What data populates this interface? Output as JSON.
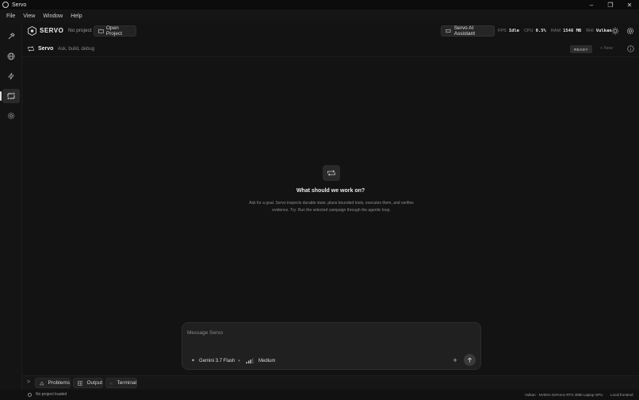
{
  "window": {
    "title": "Servo",
    "controls": [
      "–",
      "❐",
      "✕"
    ]
  },
  "menu": [
    "File",
    "View",
    "Window",
    "Help"
  ],
  "activity": [
    "hammer-icon",
    "globe-icon",
    "lightning-icon",
    "chat-icon",
    "gear-icon"
  ],
  "header": {
    "brand": "SERVO",
    "project_status": "No project",
    "open_project": "Open Project",
    "ai_assistant": "Servo AI Assistant",
    "stats": [
      {
        "label": "FPS",
        "value": "Idle"
      },
      {
        "label": "CPU",
        "value": "0.5%"
      },
      {
        "label": "RAM",
        "value": "1546 MB"
      },
      {
        "label": "RHI",
        "value": "Vulkan"
      }
    ]
  },
  "subheader": {
    "title": "Servo",
    "caption": "Ask, build, debug",
    "badge": "READY",
    "new_label": "+ New"
  },
  "empty_state": {
    "title": "What should we work on?",
    "description": "Ask for a goal. Servo inspects durable state, plans bounded tools, executes them, and verifies evidence. Try: Run the selected campaign through the agentic loop."
  },
  "composer": {
    "placeholder": "Message Servo",
    "model": "Gemini 3.7 Flash",
    "effort": "Medium",
    "attach": "+"
  },
  "panel": {
    "toggle": ">",
    "tabs": [
      "Problems",
      "Output",
      "Terminal"
    ]
  },
  "status": {
    "project": "No project loaded",
    "gpu": "Vulkan · NVIDIA GeForce RTX 4080 Laptop GPU",
    "runtime": "Local frontend"
  }
}
